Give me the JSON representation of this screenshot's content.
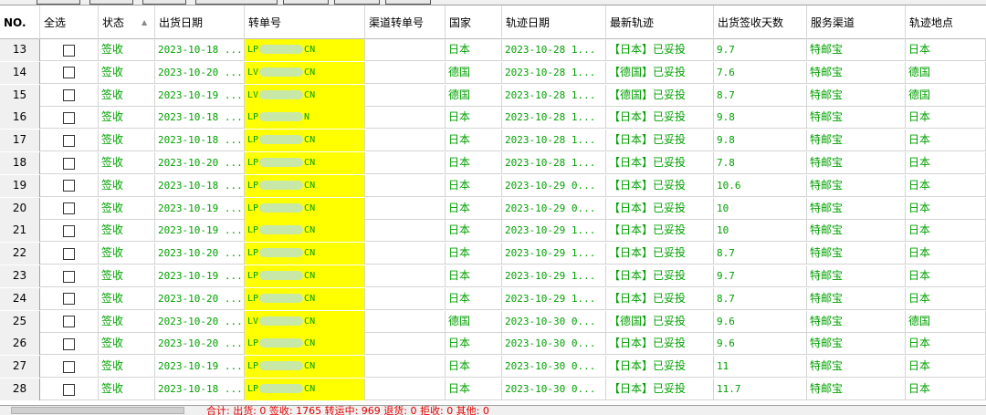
{
  "headers": {
    "no": "NO.",
    "select_all": "全选",
    "status": "状态",
    "ship_date": "出货日期",
    "track_no": "转单号",
    "channel_track": "渠道转单号",
    "country": "国家",
    "track_date": "轨迹日期",
    "latest_track": "最新轨迹",
    "days": "出货签收天数",
    "service": "服务渠道",
    "location": "轨迹地点"
  },
  "rows": [
    {
      "no": "13",
      "status": "签收",
      "ship_date": "2023-10-18 ...",
      "track_pre": "LP",
      "track_post": "CN",
      "country": "日本",
      "track_date": "2023-10-28 1...",
      "latest": "【日本】已妥投",
      "days": "9.7",
      "service": "特邮宝",
      "location": "日本"
    },
    {
      "no": "14",
      "status": "签收",
      "ship_date": "2023-10-20 ...",
      "track_pre": "LV",
      "track_post": "CN",
      "country": "德国",
      "track_date": "2023-10-28 1...",
      "latest": "【德国】已妥投",
      "days": "7.6",
      "service": "特邮宝",
      "location": "德国"
    },
    {
      "no": "15",
      "status": "签收",
      "ship_date": "2023-10-19 ...",
      "track_pre": "LV",
      "track_post": "CN",
      "country": "德国",
      "track_date": "2023-10-28 1...",
      "latest": "【德国】已妥投",
      "days": "8.7",
      "service": "特邮宝",
      "location": "德国"
    },
    {
      "no": "16",
      "status": "签收",
      "ship_date": "2023-10-18 ...",
      "track_pre": "LP",
      "track_post": "N",
      "country": "日本",
      "track_date": "2023-10-28 1...",
      "latest": "【日本】已妥投",
      "days": "9.8",
      "service": "特邮宝",
      "location": "日本"
    },
    {
      "no": "17",
      "status": "签收",
      "ship_date": "2023-10-18 ...",
      "track_pre": "LP",
      "track_post": "CN",
      "country": "日本",
      "track_date": "2023-10-28 1...",
      "latest": "【日本】已妥投",
      "days": "9.8",
      "service": "特邮宝",
      "location": "日本"
    },
    {
      "no": "18",
      "status": "签收",
      "ship_date": "2023-10-20 ...",
      "track_pre": "LP",
      "track_post": "CN",
      "country": "日本",
      "track_date": "2023-10-28 1...",
      "latest": "【日本】已妥投",
      "days": "7.8",
      "service": "特邮宝",
      "location": "日本"
    },
    {
      "no": "19",
      "status": "签收",
      "ship_date": "2023-10-18 ...",
      "track_pre": "LP",
      "track_post": "CN",
      "country": "日本",
      "track_date": "2023-10-29 0...",
      "latest": "【日本】已妥投",
      "days": "10.6",
      "service": "特邮宝",
      "location": "日本"
    },
    {
      "no": "20",
      "status": "签收",
      "ship_date": "2023-10-19 ...",
      "track_pre": "LP",
      "track_post": "CN",
      "country": "日本",
      "track_date": "2023-10-29 0...",
      "latest": "【日本】已妥投",
      "days": "10",
      "service": "特邮宝",
      "location": "日本"
    },
    {
      "no": "21",
      "status": "签收",
      "ship_date": "2023-10-19 ...",
      "track_pre": "LP",
      "track_post": "CN",
      "country": "日本",
      "track_date": "2023-10-29 1...",
      "latest": "【日本】已妥投",
      "days": "10",
      "service": "特邮宝",
      "location": "日本"
    },
    {
      "no": "22",
      "status": "签收",
      "ship_date": "2023-10-20 ...",
      "track_pre": "LP",
      "track_post": "CN",
      "country": "日本",
      "track_date": "2023-10-29 1...",
      "latest": "【日本】已妥投",
      "days": "8.7",
      "service": "特邮宝",
      "location": "日本"
    },
    {
      "no": "23",
      "status": "签收",
      "ship_date": "2023-10-19 ...",
      "track_pre": "LP",
      "track_post": "CN",
      "country": "日本",
      "track_date": "2023-10-29 1...",
      "latest": "【日本】已妥投",
      "days": "9.7",
      "service": "特邮宝",
      "location": "日本"
    },
    {
      "no": "24",
      "status": "签收",
      "ship_date": "2023-10-20 ...",
      "track_pre": "LP",
      "track_post": "CN",
      "country": "日本",
      "track_date": "2023-10-29 1...",
      "latest": "【日本】已妥投",
      "days": "8.7",
      "service": "特邮宝",
      "location": "日本"
    },
    {
      "no": "25",
      "status": "签收",
      "ship_date": "2023-10-20 ...",
      "track_pre": "LV",
      "track_post": "CN",
      "country": "德国",
      "track_date": "2023-10-30 0...",
      "latest": "【德国】已妥投",
      "days": "9.6",
      "service": "特邮宝",
      "location": "德国"
    },
    {
      "no": "26",
      "status": "签收",
      "ship_date": "2023-10-20 ...",
      "track_pre": "LP",
      "track_post": "CN",
      "country": "日本",
      "track_date": "2023-10-30 0...",
      "latest": "【日本】已妥投",
      "days": "9.6",
      "service": "特邮宝",
      "location": "日本"
    },
    {
      "no": "27",
      "status": "签收",
      "ship_date": "2023-10-19 ...",
      "track_pre": "LP",
      "track_post": "CN",
      "country": "日本",
      "track_date": "2023-10-30 0...",
      "latest": "【日本】已妥投",
      "days": "11",
      "service": "特邮宝",
      "location": "日本"
    },
    {
      "no": "28",
      "status": "签收",
      "ship_date": "2023-10-18 ...",
      "track_pre": "LP",
      "track_post": "CN",
      "country": "日本",
      "track_date": "2023-10-30 0...",
      "latest": "【日本】已妥投",
      "days": "11.7",
      "service": "特邮宝",
      "location": "日本"
    }
  ],
  "footer": {
    "summary": "合计:  出货: 0  签收: 1765  转运中: 969  退货: 0  拒收: 0  其他: 0"
  },
  "colors": {
    "green_text": "#00a000",
    "highlight": "#ffff00",
    "summary_red": "#e00000"
  },
  "icons": {
    "sort": "sort-up-arrow-icon",
    "checkbox": "checkbox-icon"
  }
}
